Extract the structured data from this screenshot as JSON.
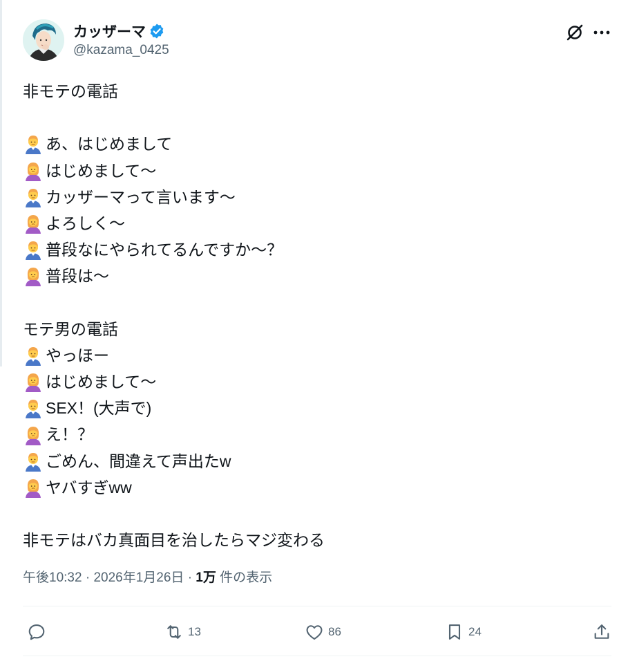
{
  "author": {
    "display_name": "カッザーマ",
    "handle": "@kazama_0425",
    "verified": true
  },
  "header_icons": {
    "grok": "grok-icon",
    "more": "more-icon"
  },
  "tweet": {
    "title": "非モテの電話",
    "section1": [
      {
        "speaker": "man",
        "text": "あ、はじめまして"
      },
      {
        "speaker": "woman",
        "text": "はじめまして〜"
      },
      {
        "speaker": "man",
        "text": "カッザーマって言います〜"
      },
      {
        "speaker": "woman",
        "text": "よろしく〜"
      },
      {
        "speaker": "man",
        "text": "普段なにやられてるんですか〜？"
      },
      {
        "speaker": "woman",
        "text": "普段は〜"
      }
    ],
    "subtitle": "モテ男の電話",
    "section2": [
      {
        "speaker": "man",
        "text": "やっほー"
      },
      {
        "speaker": "woman",
        "text": "はじめまして〜"
      },
      {
        "speaker": "man",
        "text": "SEX！(大声で)"
      },
      {
        "speaker": "woman",
        "text": "え！？"
      },
      {
        "speaker": "man",
        "text": "ごめん、間違えて声出たw"
      },
      {
        "speaker": "woman",
        "text": "ヤバすぎww"
      }
    ],
    "conclusion": "非モテはバカ真面目を治したらマジ変わる"
  },
  "meta": {
    "time": "午後10:32",
    "separator": "·",
    "date": "2026年1月26日",
    "views_count": "1万",
    "views_label": "件の表示"
  },
  "actions": {
    "reply_count": "",
    "retweet_count": "13",
    "like_count": "86",
    "bookmark_count": "24"
  },
  "colors": {
    "text": "#0f1419",
    "secondary": "#536471",
    "verified": "#1d9bf0",
    "divider": "#eff3f4"
  }
}
